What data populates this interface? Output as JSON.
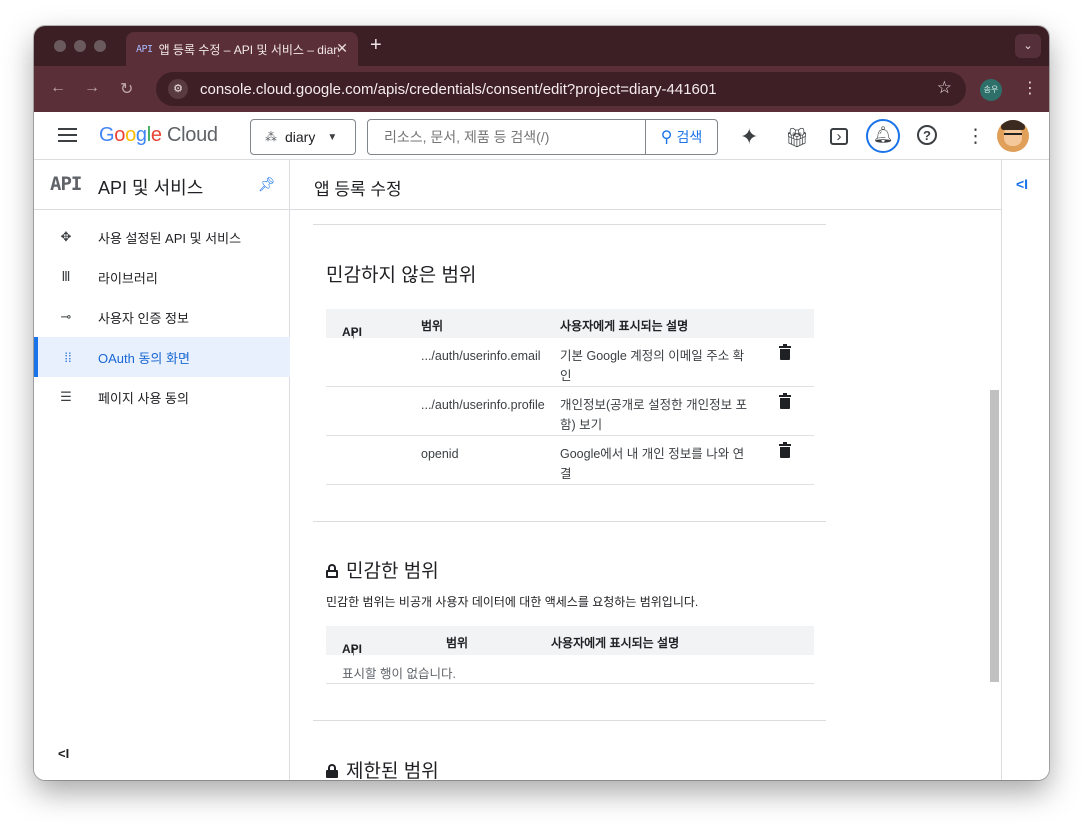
{
  "browser": {
    "tab_favicon": "API",
    "tab_title": "앱 등록 수정 – API 및 서비스 – diary",
    "tab_close": "✕",
    "new_tab": "+",
    "tab_menu": "⌄",
    "url": "console.cloud.google.com/apis/credentials/consent/edit?project=diary-441601",
    "profile_label": "송우"
  },
  "header": {
    "logo_google": [
      "G",
      "o",
      "o",
      "g",
      "l",
      "e"
    ],
    "logo_cloud": "Cloud",
    "project_name": "diary",
    "search_placeholder": "리소스, 문서, 제품 등 검색(/)",
    "search_button": "검색"
  },
  "sidebar": {
    "icon_text": "API",
    "title": "API 및 서비스",
    "items": [
      {
        "label": "사용 설정된 API 및 서비스",
        "icon": "diamond-arrows-icon"
      },
      {
        "label": "라이브러리",
        "icon": "library-icon"
      },
      {
        "label": "사용자 인증 정보",
        "icon": "key-icon"
      },
      {
        "label": "OAuth 동의 화면",
        "icon": "dots-grid-icon",
        "active": true
      },
      {
        "label": "페이지 사용 동의",
        "icon": "settings-list-icon"
      }
    ],
    "collapse_label": "<I"
  },
  "main": {
    "page_title": "앱 등록 수정",
    "nonsensitive": {
      "title": "민감하지 않은 범위",
      "columns": {
        "api": "API",
        "scope": "범위",
        "desc": "사용자에게 표시되는 설명"
      },
      "rows": [
        {
          "scope": ".../auth/userinfo.email",
          "description": "기본 Google 계정의 이메일 주소 확인"
        },
        {
          "scope": ".../auth/userinfo.profile",
          "description": "개인정보(공개로 설정한 개인정보 포함) 보기"
        },
        {
          "scope": "openid",
          "description": "Google에서 내 개인 정보를 나와 연결"
        }
      ]
    },
    "sensitive": {
      "title": "민감한 범위",
      "description": "민감한 범위는 비공개 사용자 데이터에 대한 액세스를 요청하는 범위입니다.",
      "columns": {
        "api": "API",
        "scope": "범위",
        "desc": "사용자에게 표시되는 설명"
      },
      "empty": "표시할 행이 없습니다."
    },
    "restricted": {
      "title": "제한된 범위"
    }
  },
  "rail": {
    "toggle_label": "<I"
  },
  "colors": {
    "accent": "#1a73e8",
    "titlebar": "#3b1f25",
    "toolbar": "#5a2f37"
  }
}
